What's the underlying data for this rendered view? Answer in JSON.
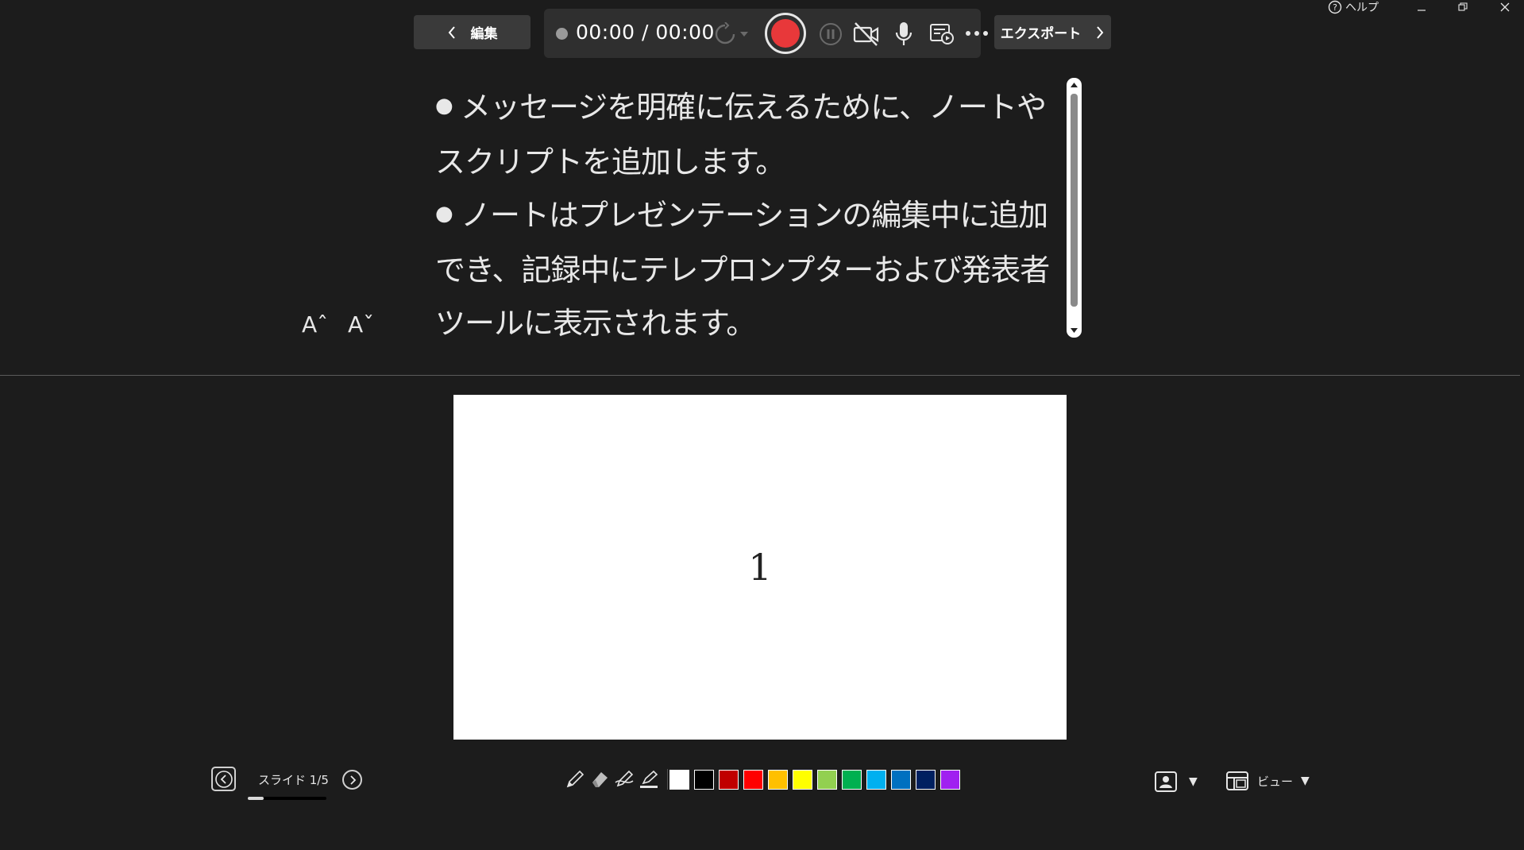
{
  "window": {
    "help_label": "ヘルプ"
  },
  "toolbar": {
    "edit_label": "編集",
    "timer": "00:00 / 00:00",
    "export_label": "エクスポート"
  },
  "notes": {
    "bullets": [
      "メッセージを明確に伝えるために、ノートやスクリプトを追加します。",
      "ノートはプレゼンテーションの編集中に追加でき、記録中にテレプロンプターおよび発表者ツールに表示されます。"
    ],
    "bullet_glyph": "●",
    "increase_font_label": "Aˆ",
    "decrease_font_label": "Aˇ"
  },
  "slide": {
    "content": "1"
  },
  "navigation": {
    "slide_label": "スライド 1/5",
    "current": 1,
    "total": 5
  },
  "pen_colors": [
    "#ffffff",
    "#000000",
    "#c00000",
    "#ff0000",
    "#ffc000",
    "#ffff00",
    "#92d050",
    "#00b050",
    "#00b0f0",
    "#0070c0",
    "#002060",
    "#a020f0"
  ],
  "bottom_right": {
    "view_label": "ビュー"
  },
  "colors": {
    "background": "#1c1c1c",
    "record": "#e8383a",
    "button_bg": "#3a3a3a"
  }
}
